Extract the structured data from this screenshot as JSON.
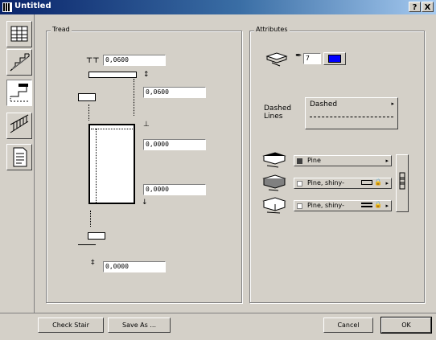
{
  "window": {
    "title": "Untitled",
    "help_label": "?",
    "close_label": "X"
  },
  "tabs": [
    {
      "name": "general-settings"
    },
    {
      "name": "stair-shape"
    },
    {
      "name": "tread"
    },
    {
      "name": "railing"
    },
    {
      "name": "listing"
    }
  ],
  "tread": {
    "legend": "Tread",
    "field_1": "0,0600",
    "field_2": "0,0600",
    "field_3": "0,0000",
    "field_4": "0,0000",
    "field_5": "0,0000"
  },
  "attributes": {
    "legend": "Attributes",
    "pen_number": "7",
    "pen_color": "#0000ff",
    "dashed_label_1": "Dashed",
    "dashed_label_2": "Lines",
    "line_type": "Dashed",
    "material_1": "Pine",
    "material_2": "Pine, shiny-",
    "material_3": "Pine, shiny-"
  },
  "footer": {
    "check_stair": "Check Stair",
    "save_as": "Save As ...",
    "cancel": "Cancel",
    "ok": "OK"
  }
}
